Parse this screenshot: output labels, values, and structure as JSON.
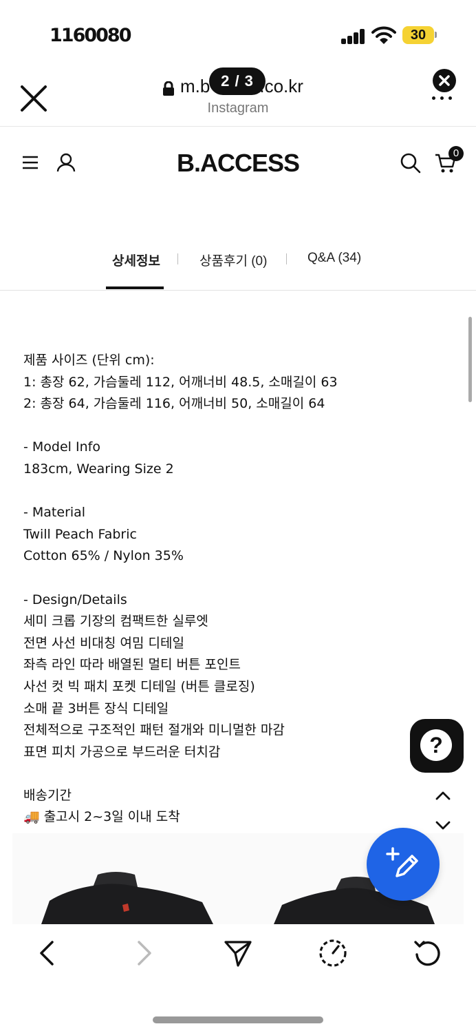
{
  "status_bar": {
    "time": "1160080",
    "battery": "30"
  },
  "browser": {
    "url_prefix": "m.b",
    "url_suffix": ".co.kr",
    "source": "Instagram",
    "page_counter": "2 / 3"
  },
  "site": {
    "brand": "B.ACCESS",
    "cart_count": "0"
  },
  "tabs": [
    {
      "label": "상세정보",
      "active": true
    },
    {
      "label": "상품후기 (0)",
      "active": false
    },
    {
      "label": "Q&A (34)",
      "active": false
    }
  ],
  "detail": {
    "size_title": "제품 사이즈 (단위 cm):",
    "size_1": "1: 총장 62, 가슴둘레 112, 어깨너비 48.5, 소매길이 63",
    "size_2": "2: 총장 64, 가슴둘레 116, 어깨너비 50, 소매길이 64",
    "model_title": "- Model Info",
    "model_text": "183cm, Wearing Size 2",
    "material_title": "- Material",
    "material_1": "Twill Peach Fabric",
    "material_2": "Cotton 65% / Nylon 35%",
    "design_title": "- Design/Details",
    "design_lines": [
      "세미 크롭 기장의 컴팩트한 실루엣",
      "전면 사선 비대칭 여밈 디테일",
      "좌측 라인 따라 배열된 멀티 버튼 포인트",
      "사선 컷 빅 패치 포켓 디테일 (버튼 클로징)",
      "소매 끝 3버튼 장식 디테일",
      "전체적으로 구조적인 패턴 절개와 미니멀한 마감",
      "표면 피치 가공으로 부드러운 터치감"
    ],
    "shipping_title": "배송기간",
    "shipping_text": "🚚 출고시 2~3일 이내 도착"
  },
  "fab": {
    "help_symbol": "?"
  },
  "colors": {
    "accent_blue": "#1f64e6",
    "battery_yellow": "#f5d233",
    "jacket_red": "#c0392b"
  },
  "icons": {
    "menu": "hamburger-icon",
    "user": "user-icon",
    "search": "search-icon",
    "cart": "cart-icon",
    "back": "chevron-left-icon",
    "forward": "chevron-right-icon",
    "share": "send-icon",
    "timer": "timer-icon",
    "reload": "reload-icon"
  }
}
